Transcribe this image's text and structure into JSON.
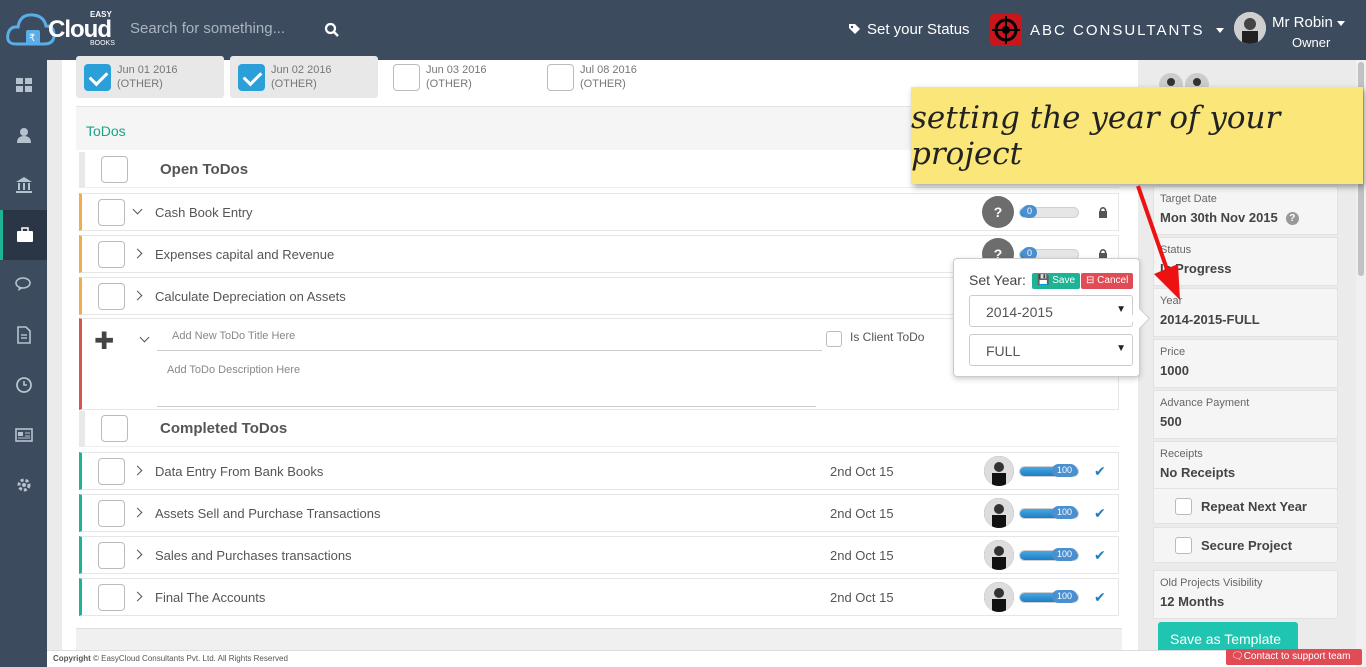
{
  "app": {
    "brand": "Cloud",
    "brand_prefix": "EASY",
    "brand_suffix": "BOOKS"
  },
  "search": {
    "placeholder": "Search for something..."
  },
  "header": {
    "status_label": "Set your Status",
    "company": "ABC CONSULTANTS",
    "user_name": "Mr Robin",
    "user_role": "Owner"
  },
  "sidebar": {
    "items": [
      "dashboard-icon",
      "user-icon",
      "bank-icon",
      "briefcase-icon",
      "chat-icon",
      "document-icon",
      "clock-icon",
      "newspaper-icon",
      "gear-icon"
    ],
    "active": "briefcase-icon"
  },
  "dates": [
    {
      "date": "Jun 01 2016",
      "tag": "(OTHER)",
      "checked": true
    },
    {
      "date": "Jun 02 2016",
      "tag": "(OTHER)",
      "checked": true
    },
    {
      "date": "Jun 03 2016",
      "tag": "(OTHER)",
      "checked": false
    },
    {
      "date": "Jul 08 2016",
      "tag": "(OTHER)",
      "checked": false
    }
  ],
  "todos": {
    "heading": "ToDos",
    "open_heading": "Open ToDos",
    "open": [
      {
        "title": "Cash Book Entry",
        "progress": 0
      },
      {
        "title": "Expenses capital and Revenue",
        "progress": 0
      },
      {
        "title": "Calculate Depreciation on Assets",
        "progress": 0
      }
    ],
    "new_title_placeholder": "Add New ToDo Title Here",
    "new_desc_placeholder": "Add ToDo Description Here",
    "client_todo_label": "Is Client ToDo",
    "completed_heading": "Completed ToDos",
    "completed": [
      {
        "title": "Data Entry From Bank Books",
        "date": "2nd Oct 15",
        "progress": "100"
      },
      {
        "title": "Assets Sell and Purchase Transactions",
        "date": "2nd Oct 15",
        "progress": "100"
      },
      {
        "title": "Sales and Purchases transactions",
        "date": "2nd Oct 15",
        "progress": "100"
      },
      {
        "title": "Final The Accounts",
        "date": "2nd Oct 15",
        "progress": "100"
      }
    ]
  },
  "popover": {
    "title": "Set Year:",
    "save": "Save",
    "cancel": "Cancel",
    "year_value": "2014-2015",
    "period_value": "FULL"
  },
  "callout": {
    "text": "setting the year of your project"
  },
  "panel": {
    "target_date_label": "Target Date",
    "target_date": "Mon 30th Nov 2015",
    "status_label": "Status",
    "status": "In Progress",
    "year_label": "Year",
    "year": "2014-2015-FULL",
    "price_label": "Price",
    "price": "1000",
    "advance_label": "Advance Payment",
    "advance": "500",
    "receipts_label": "Receipts",
    "receipts": "No Receipts",
    "repeat_label": "Repeat Next Year",
    "secure_label": "Secure Project",
    "visibility_label": "Old Projects Visibility",
    "visibility": "12 Months",
    "template_button": "Save as Template"
  },
  "footer": {
    "copyright_bold": "Copyright",
    "copyright": "© EasyCloud Consultants Pvt. Ltd. All Rights Reserved",
    "support": "Contact to support team"
  },
  "colors": {
    "topbar": "#3d4b5e",
    "accent": "#1db394",
    "open_border": "#f0ad4e",
    "new_border": "#d9534f",
    "check_blue": "#2ba0d8",
    "callout": "#fbe67a"
  }
}
